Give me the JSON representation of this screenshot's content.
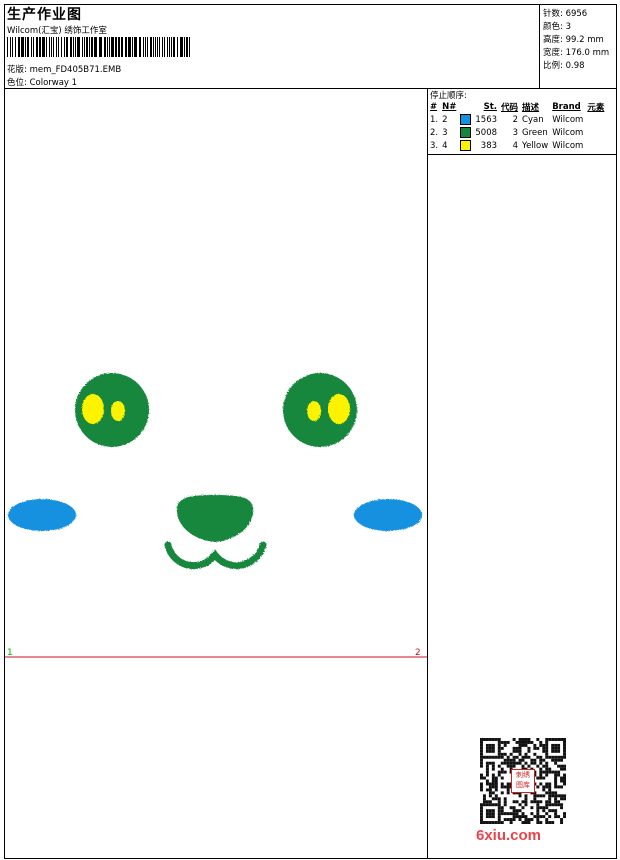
{
  "header": {
    "title": "生产作业图",
    "company": "Wilcom(汇宝) 绣饰工作室",
    "design_label": "花版:",
    "design_value": "mem_FD405B71.EMB",
    "colorway_label": "色位:",
    "colorway_value": "Colorway 1"
  },
  "stats": [
    {
      "label": "针数:",
      "value": "6956"
    },
    {
      "label": "颜色:",
      "value": "3"
    },
    {
      "label": "高度:",
      "value": "99.2 mm"
    },
    {
      "label": "宽度:",
      "value": "176.0 mm"
    },
    {
      "label": "比例:",
      "value": "0.98"
    }
  ],
  "stop_sequence": {
    "heading": "停止顺序:",
    "columns": [
      "#",
      "N#",
      "St.",
      "代码",
      "描述",
      "Brand",
      "元素"
    ],
    "rows": [
      {
        "idx": "1.",
        "needle": "2",
        "stitches": "1563",
        "code": "2",
        "desc": "Cyan",
        "brand": "Wilcom",
        "color": "#1591e0"
      },
      {
        "idx": "2.",
        "needle": "3",
        "stitches": "5008",
        "code": "3",
        "desc": "Green",
        "brand": "Wilcom",
        "color": "#14873e"
      },
      {
        "idx": "3.",
        "needle": "4",
        "stitches": "383",
        "code": "4",
        "desc": "Yellow",
        "brand": "Wilcom",
        "color": "#fdf200"
      }
    ]
  },
  "preview": {
    "marker_start": "1",
    "marker_end": "2",
    "colors": {
      "cyan": "#1591e0",
      "green": "#14873e",
      "yellow": "#fdf200",
      "guide": "#c8102e",
      "start": "#00b000"
    }
  },
  "watermark": {
    "text": "6xiu.com",
    "seal_lines": [
      "刺绣",
      "图库"
    ]
  }
}
